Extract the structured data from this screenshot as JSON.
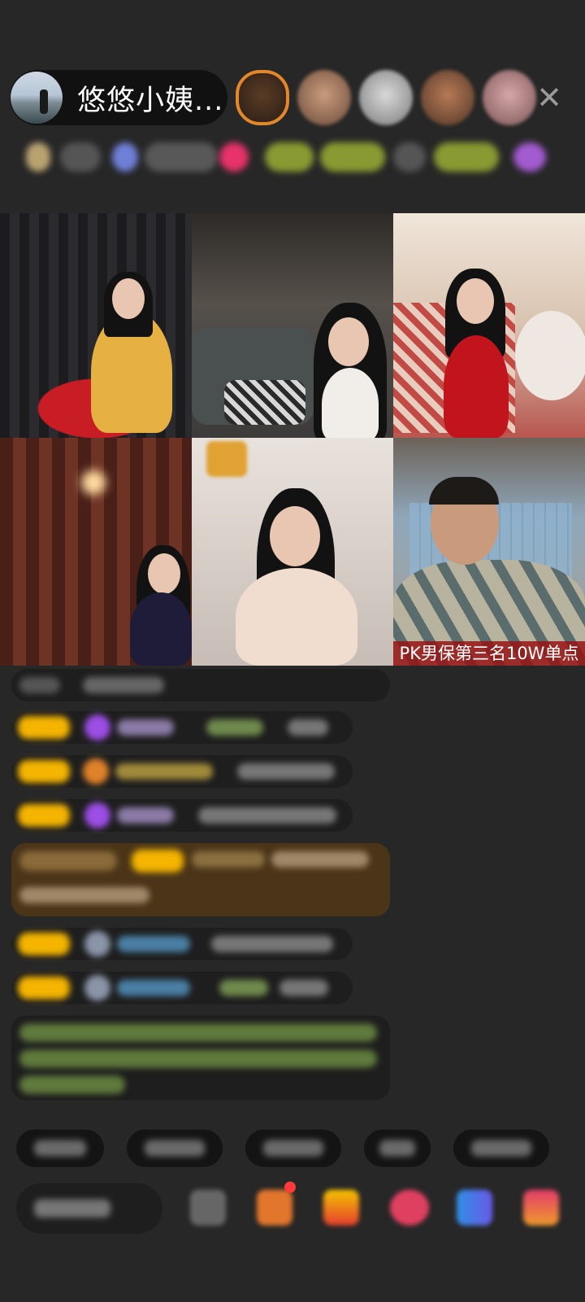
{
  "header": {
    "host_name": "悠悠小姨...",
    "close_glyph": "✕",
    "viewer_count_shown": 5
  },
  "video_grid": {
    "tiles": [
      {
        "id": 1
      },
      {
        "id": 2
      },
      {
        "id": 3
      },
      {
        "id": 4
      },
      {
        "id": 5
      },
      {
        "id": 6,
        "caption": "PK男保第三名10W单点"
      }
    ]
  },
  "icons": {
    "close": "close-icon",
    "avatar": "host-avatar",
    "gift": "gift-icon"
  },
  "colors": {
    "background": "#272727",
    "chat_bubble": "#1e1e1e",
    "level_badge": "#f4b400",
    "accent_orange": "#e2872c",
    "caption_bg": "#961414"
  }
}
